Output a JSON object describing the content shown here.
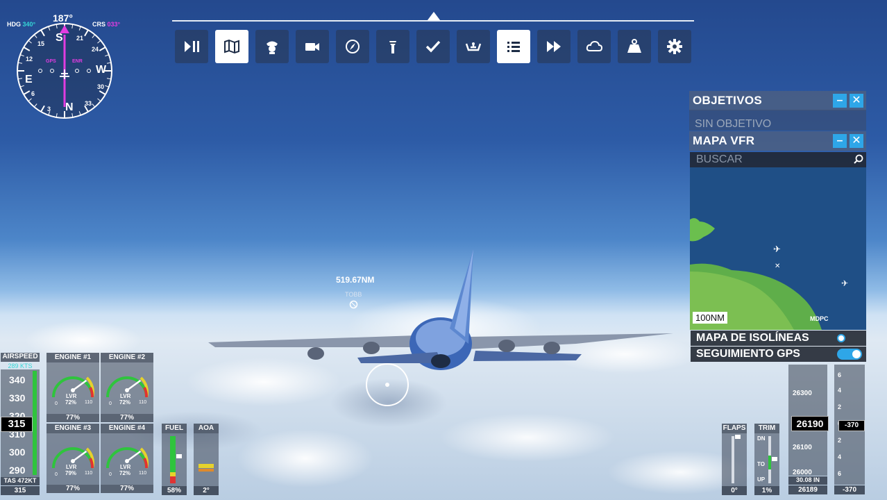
{
  "compass": {
    "heading": "187°",
    "hdg_label": "HDG",
    "hdg_value": "340°",
    "crs_label": "CRS",
    "crs_value": "033°",
    "gps_label": "GPS",
    "enr_label": "ENR",
    "cardinals": [
      "N",
      "E",
      "S",
      "W"
    ],
    "numbers": [
      "3",
      "6",
      "12",
      "15",
      "21",
      "24",
      "30",
      "33"
    ]
  },
  "toolbar": {
    "active": [
      "map",
      "list"
    ],
    "buttons": [
      {
        "name": "pause-play",
        "icon": "pause-play-icon"
      },
      {
        "name": "map",
        "icon": "map-icon"
      },
      {
        "name": "atc",
        "icon": "pilot-icon"
      },
      {
        "name": "camera",
        "icon": "camera-icon"
      },
      {
        "name": "navlog",
        "icon": "compass-icon"
      },
      {
        "name": "tower",
        "icon": "tower-icon"
      },
      {
        "name": "checklist",
        "icon": "check-icon"
      },
      {
        "name": "controls",
        "icon": "yoke-icon"
      },
      {
        "name": "objectives",
        "icon": "list-icon"
      },
      {
        "name": "sim-rate",
        "icon": "fast-forward-icon"
      },
      {
        "name": "weather",
        "icon": "cloud-icon"
      },
      {
        "name": "weight",
        "icon": "weight-icon"
      },
      {
        "name": "settings",
        "icon": "gear-icon"
      }
    ]
  },
  "scene": {
    "waypoint_distance": "519.67NM",
    "waypoint_name": "TOBB"
  },
  "objectives_panel": {
    "title": "OBJETIVOS",
    "content": "SIN OBJETIVO"
  },
  "vfr_map": {
    "title": "MAPA VFR",
    "search_placeholder": "BUSCAR",
    "scale": "100NM",
    "airport_label": "MDPC",
    "isolines_label": "MAPA DE ISOLÍNEAS",
    "isolines_on": false,
    "gps_follow_label": "SEGUIMIENTO GPS",
    "gps_follow_on": true
  },
  "airspeed": {
    "title": "AIRSPEED",
    "trend": "289 KTS",
    "ticks": [
      "340",
      "330",
      "320",
      "310",
      "300",
      "290"
    ],
    "current": "315",
    "tas": "TAS 472KT",
    "footer": "315"
  },
  "engines": [
    {
      "title": "ENGINE #1",
      "label": "LVR",
      "lvr": "72%",
      "min": "0",
      "max": "110",
      "footer": "77%",
      "value": 77
    },
    {
      "title": "ENGINE #2",
      "label": "LVR",
      "lvr": "72%",
      "min": "0",
      "max": "110",
      "footer": "77%",
      "value": 77
    },
    {
      "title": "ENGINE #3",
      "label": "LVR",
      "lvr": "79%",
      "min": "0",
      "max": "110",
      "footer": "77%",
      "value": 77
    },
    {
      "title": "ENGINE #4",
      "label": "LVR",
      "lvr": "72%",
      "min": "0",
      "max": "110",
      "footer": "77%",
      "value": 77
    }
  ],
  "fuel": {
    "title": "FUEL",
    "footer": "58%",
    "value": 58
  },
  "aoa": {
    "title": "AOA",
    "footer": "2°"
  },
  "flaps": {
    "title": "FLAPS",
    "footer": "0°"
  },
  "trim": {
    "title": "TRIM",
    "dn": "DN",
    "to": "TO",
    "up": "UP",
    "footer": "1%"
  },
  "altimeter": {
    "ticks": [
      "26300",
      "26200",
      "26100",
      "26000"
    ],
    "current": "26190",
    "baro": "30.08 IN",
    "footer": "26189"
  },
  "vsi": {
    "ticks": [
      "6",
      "4",
      "2",
      "0",
      "2",
      "4",
      "6"
    ],
    "current": "-370",
    "footer": "-370"
  }
}
